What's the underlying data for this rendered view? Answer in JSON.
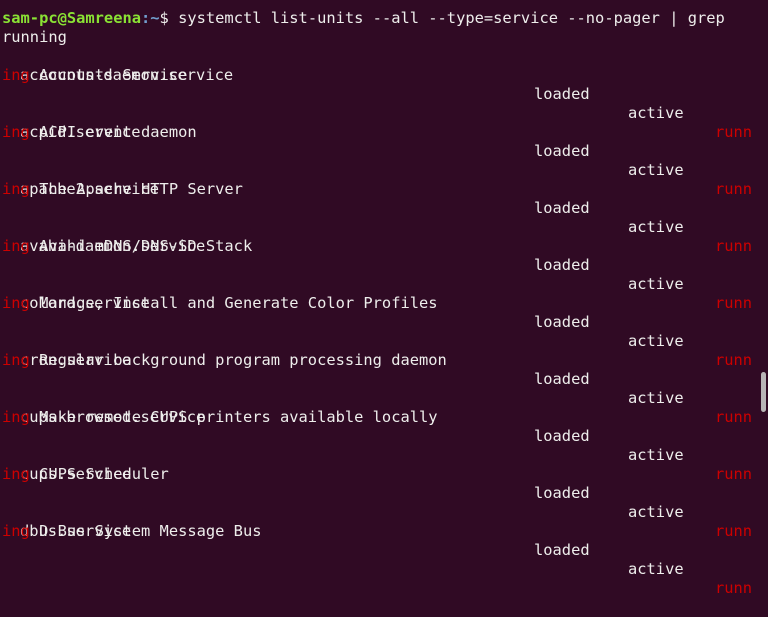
{
  "terminal": {
    "prev_line_fragment": "",
    "prompt": {
      "user_host": "sam-pc@Samreena",
      "path": ":~",
      "symbol": "$ "
    },
    "command": "systemctl list-units --all --type=service --no-pager | grep",
    "command_wrap": "running",
    "wrap_prefix": "ing",
    "services": [
      {
        "unit": "accounts-daemon.service",
        "load": "loaded",
        "active": "active",
        "sub": "runn",
        "description": "Accounts Service"
      },
      {
        "unit": "acpid.service",
        "load": "loaded",
        "active": "active",
        "sub": "runn",
        "description": "ACPI event daemon"
      },
      {
        "unit": "apache2.service",
        "load": "loaded",
        "active": "active",
        "sub": "runn",
        "description": "The Apache HTTP Server"
      },
      {
        "unit": "avahi-daemon.service",
        "load": "loaded",
        "active": "active",
        "sub": "runn",
        "description": "Avahi mDNS/DNS-SD Stack"
      },
      {
        "unit": "colord.service",
        "load": "loaded",
        "active": "active",
        "sub": "runn",
        "description": "Manage, Install and Generate Color Profiles"
      },
      {
        "unit": "cron.service",
        "load": "loaded",
        "active": "active",
        "sub": "runn",
        "description": "Regular background program processing daemon"
      },
      {
        "unit": "cups-browsed.service",
        "load": "loaded",
        "active": "active",
        "sub": "runn",
        "description": "Make remote CUPS printers available locally"
      },
      {
        "unit": "cups.service",
        "load": "loaded",
        "active": "active",
        "sub": "runn",
        "description": "CUPS Scheduler"
      },
      {
        "unit": "dbus.service",
        "load": "loaded",
        "active": "active",
        "sub": "runn",
        "description": "D-Bus System Message Bus"
      }
    ]
  }
}
